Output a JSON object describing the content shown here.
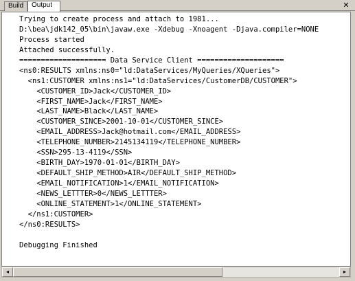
{
  "tabs": [
    {
      "label": "Build",
      "active": false
    },
    {
      "label": "Output",
      "active": true
    }
  ],
  "close_icon": "close-icon",
  "output_lines": [
    "Trying to create process and attach to 1981...",
    "D:\\bea\\jdk142_05\\bin\\javaw.exe -Xdebug -Xnoagent -Djava.compiler=NONE",
    "Process started",
    "Attached successfully.",
    "==================== Data Service Client ====================",
    "<ns0:RESULTS xmlns:ns0=\"ld:DataServices/MyQueries/XQueries\">",
    "  <ns1:CUSTOMER xmlns:ns1=\"ld:DataServices/CustomerDB/CUSTOMER\">",
    "    <CUSTOMER_ID>Jack</CUSTOMER_ID>",
    "    <FIRST_NAME>Jack</FIRST_NAME>",
    "    <LAST_NAME>Black</LAST_NAME>",
    "    <CUSTOMER_SINCE>2001-10-01</CUSTOMER_SINCE>",
    "    <EMAIL_ADDRESS>Jack@hotmail.com</EMAIL_ADDRESS>",
    "    <TELEPHONE_NUMBER>2145134119</TELEPHONE_NUMBER>",
    "    <SSN>295-13-4119</SSN>",
    "    <BIRTH_DAY>1970-01-01</BIRTH_DAY>",
    "    <DEFAULT_SHIP_METHOD>AIR</DEFAULT_SHIP_METHOD>",
    "    <EMAIL_NOTIFICATION>1</EMAIL_NOTIFICATION>",
    "    <NEWS_LETTTER>0</NEWS_LETTTER>",
    "    <ONLINE_STATEMENT>1</ONLINE_STATEMENT>",
    "  </ns1:CUSTOMER>",
    "</ns0:RESULTS>",
    "",
    "Debugging Finished"
  ],
  "scroll_arrows": {
    "left": "◂",
    "right": "▸"
  }
}
